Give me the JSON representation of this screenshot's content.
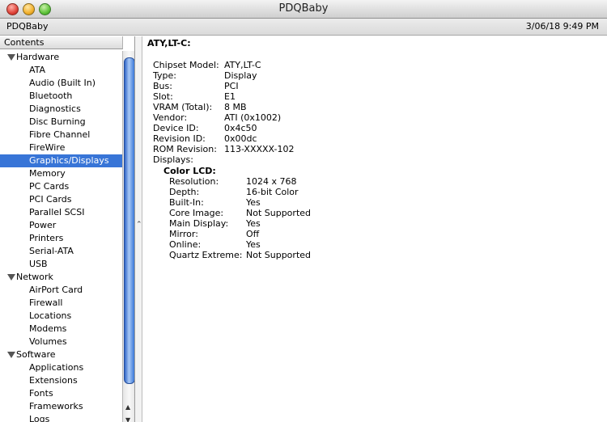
{
  "window": {
    "title": "PDQBaby"
  },
  "infobar": {
    "host": "PDQBaby",
    "datetime": "3/06/18 9:49 PM"
  },
  "sidebar": {
    "header": "Contents",
    "groups": [
      {
        "label": "Hardware",
        "items": [
          "ATA",
          "Audio (Built In)",
          "Bluetooth",
          "Diagnostics",
          "Disc Burning",
          "Fibre Channel",
          "FireWire",
          "Graphics/Displays",
          "Memory",
          "PC Cards",
          "PCI Cards",
          "Parallel SCSI",
          "Power",
          "Printers",
          "Serial-ATA",
          "USB"
        ]
      },
      {
        "label": "Network",
        "items": [
          "AirPort Card",
          "Firewall",
          "Locations",
          "Modems",
          "Volumes"
        ]
      },
      {
        "label": "Software",
        "items": [
          "Applications",
          "Extensions",
          "Fonts",
          "Frameworks",
          "Logs"
        ]
      }
    ],
    "selected": "Graphics/Displays"
  },
  "detail": {
    "title": "ATY,LT-C:",
    "properties": [
      {
        "k": "Chipset Model:",
        "v": "ATY,LT-C"
      },
      {
        "k": "Type:",
        "v": "Display"
      },
      {
        "k": "Bus:",
        "v": "PCI"
      },
      {
        "k": "Slot:",
        "v": "E1"
      },
      {
        "k": "VRAM (Total):",
        "v": "8 MB"
      },
      {
        "k": "Vendor:",
        "v": "ATI (0x1002)"
      },
      {
        "k": "Device ID:",
        "v": "0x4c50"
      },
      {
        "k": "Revision ID:",
        "v": "0x00dc"
      },
      {
        "k": "ROM Revision:",
        "v": "113-XXXXX-102"
      },
      {
        "k": "Displays:",
        "v": ""
      }
    ],
    "display_name": "Color LCD:",
    "display_properties": [
      {
        "k": "Resolution:",
        "v": "1024 x 768"
      },
      {
        "k": "Depth:",
        "v": "16-bit Color"
      },
      {
        "k": "Built-In:",
        "v": "Yes"
      },
      {
        "k": "Core Image:",
        "v": "Not Supported"
      },
      {
        "k": "Main Display:",
        "v": "Yes"
      },
      {
        "k": "Mirror:",
        "v": "Off"
      },
      {
        "k": "Online:",
        "v": "Yes"
      },
      {
        "k": "Quartz Extreme:",
        "v": "Not Supported"
      }
    ]
  }
}
